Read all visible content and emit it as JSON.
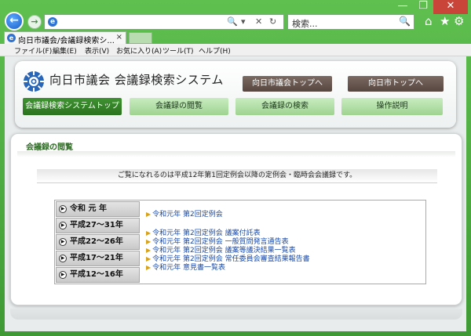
{
  "browser": {
    "search_placeholder": "検索...",
    "tab_title": "向日市議会/会議録検索シ...",
    "tab_close": "×",
    "window_controls": [
      "—",
      "❐",
      "✕"
    ],
    "addr_controls": [
      "🔍",
      "▾",
      "✕",
      "↻"
    ],
    "menu": [
      "ファイル(F)",
      "編集(E)",
      "表示(V)",
      "お気に入り(A)",
      "ツール(T)",
      "ヘルプ(H)"
    ]
  },
  "header": {
    "site_title": "向日市議会 会議録検索システム",
    "top_links": [
      "向日市議会トップへ",
      "向日市トップへ"
    ],
    "nav": [
      {
        "label": "会議録検索システムトップ",
        "active": true
      },
      {
        "label": "会議録の閲覧",
        "active": false
      },
      {
        "label": "会議録の検索",
        "active": false
      },
      {
        "label": "操作説明",
        "active": false
      }
    ]
  },
  "main": {
    "section_title": "会議録の閲覧",
    "notice": "ご覧になれるのは平成12年第1回定例会以降の定例会・臨時会会議録です。",
    "years": [
      "令和 元 年",
      "平成27～31年",
      "平成22～26年",
      "平成17～21年",
      "平成12～16年"
    ],
    "meetings": [
      "令和元年 第2回定例会",
      "令和元年 第2回定例会 議案付託表",
      "令和元年 第2回定例会 一般質問発言通告表",
      "令和元年 第2回定例会 議案等議決結果一覧表",
      "令和元年 第2回定例会 常任委員会審査結果報告書",
      "令和元年 意見書一覧表"
    ],
    "meeting_bullet": "▶"
  },
  "colors": {
    "frame": "#3f9a35",
    "nav_active": "#2b7320",
    "nav_normal": "#9fd391",
    "top_link": "#56463f",
    "link": "#1a4aa8",
    "bullet": "#d8a21a"
  }
}
